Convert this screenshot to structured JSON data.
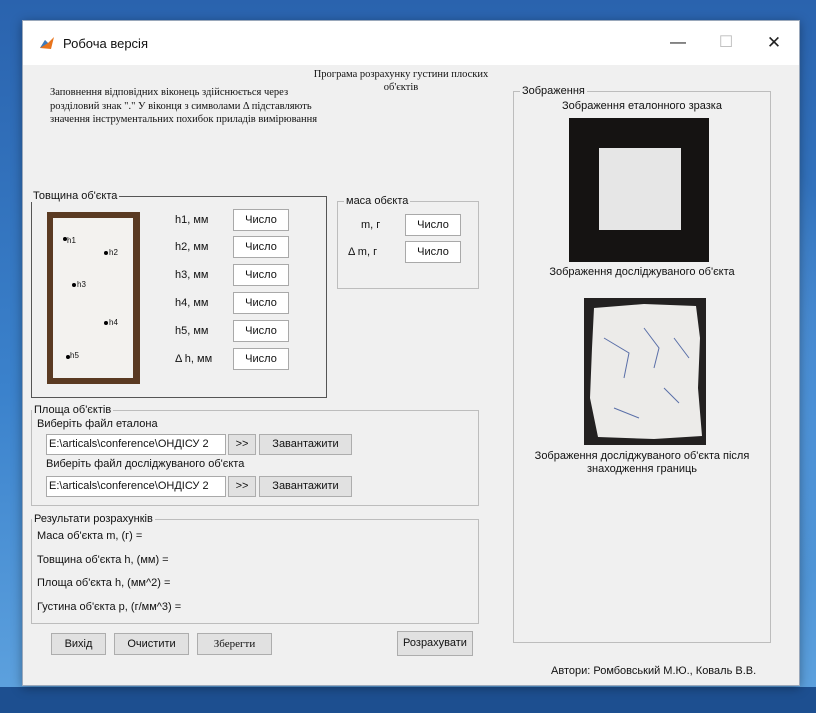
{
  "window": {
    "title": "Робоча версія",
    "controls": {
      "minimize": "—",
      "maximize": "☐",
      "close": "✕"
    }
  },
  "instructions": "Заповнення відповідних віконець здійснюється через розділовий знак \".\" У віконця з символами Δ підставляють значення інструментальних похибок приладів вимірювання",
  "program_title": "Програма розрахунку густини плоских об'єктів",
  "thickness": {
    "legend": "Товщина об'єкта",
    "photo_points": [
      "h1",
      "h2",
      "h3",
      "h4",
      "h5"
    ],
    "rows": [
      {
        "label": "h1, мм",
        "value": "Число"
      },
      {
        "label": "h2, мм",
        "value": "Число"
      },
      {
        "label": "h3, мм",
        "value": "Число"
      },
      {
        "label": "h4, мм",
        "value": "Число"
      },
      {
        "label": "h5, мм",
        "value": "Число"
      },
      {
        "label": "Δ h, мм",
        "value": "Число"
      }
    ]
  },
  "mass": {
    "legend": "маса обєкта",
    "rows": [
      {
        "label": "m, г",
        "value": "Число"
      },
      {
        "label": "Δ m, г",
        "value": "Число"
      }
    ]
  },
  "area": {
    "legend": "Площа об'єктів",
    "ref_label": "Виберіть файл еталона",
    "ref_path": "E:\\articals\\conference\\ОНДІСУ 2",
    "obj_label": "Виберіть файл досліджуваного об'єкта",
    "obj_path": "E:\\articals\\conference\\ОНДІСУ 2",
    "browse": ">>",
    "load": "Завантажити"
  },
  "results": {
    "legend": "Результати розрахунків",
    "lines": [
      "Маса об'єкта  m, (г) =",
      "Товщина об'єкта  h, (мм) =",
      "Площа об'єкта  h, (мм^2) =",
      "Густина об'єкта  р, (г/мм^3) ="
    ]
  },
  "buttons": {
    "exit": "Вихід",
    "clear": "Очистити",
    "save": "Зберегти",
    "calculate": "Розрахувати"
  },
  "images_panel": {
    "legend": "Зображення",
    "ref_caption": "Зображення еталонного зразка",
    "obj_caption": "Зображення досліджуваного об'єкта",
    "boundary_caption": "Зображення досліджуваного об'єкта після знаходження границь"
  },
  "authors": "Автори: Ромбовський М.Ю., Коваль В.В.",
  "colors": {
    "accent": "#2f6fb8",
    "window_bg": "#f0f0f0",
    "button_bg": "#e1e1e1"
  }
}
